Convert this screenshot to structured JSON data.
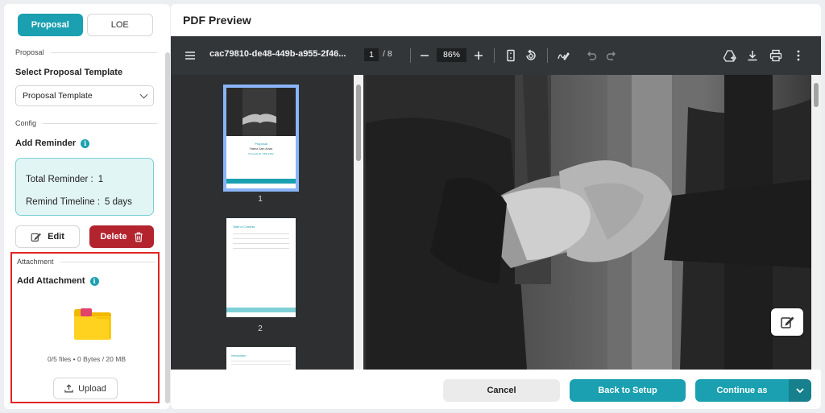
{
  "left_panel": {
    "tabs": [
      {
        "label": "Proposal",
        "active": true
      },
      {
        "label": "LOE",
        "active": false
      }
    ],
    "proposal_section_label": "Proposal",
    "template_title": "Select Proposal Template",
    "template_value": "Proposal Template",
    "config_section_label": "Config",
    "reminder_title": "Add Reminder",
    "total_reminder_label": "Total Reminder :",
    "total_reminder_value": "1",
    "remind_timeline_label": "Remind Timeline :",
    "remind_timeline_value": "5 days",
    "edit_label": "Edit",
    "delete_label": "Delete",
    "attachment_section_label": "Attachment",
    "attachment_title": "Add Attachment",
    "files_summary": "0/5 files • 0 Bytes / 20 MB",
    "upload_label": "Upload"
  },
  "preview": {
    "title": "PDF Preview",
    "filename": "cac79810-de48-449b-a955-2f46...",
    "current_page": "1",
    "total_pages": "/ 8",
    "zoom": "86%",
    "thumbnails": [
      {
        "number": "1",
        "cover_title": "Proposal",
        "cover_subtitle": "Fatima Sam Aman",
        "cover_meta": "Proposal ID: PPR-1052"
      },
      {
        "number": "2",
        "heading": "Table of Contents"
      },
      {
        "number": "",
        "heading": "Introduction"
      }
    ]
  },
  "footer": {
    "cancel_label": "Cancel",
    "back_label": "Back to Setup",
    "continue_label": "Continue as"
  },
  "colors": {
    "accent": "#1aa0b0",
    "danger": "#b3242f",
    "highlight_border": "#e02424",
    "viewer_bg": "#2d2f31"
  }
}
